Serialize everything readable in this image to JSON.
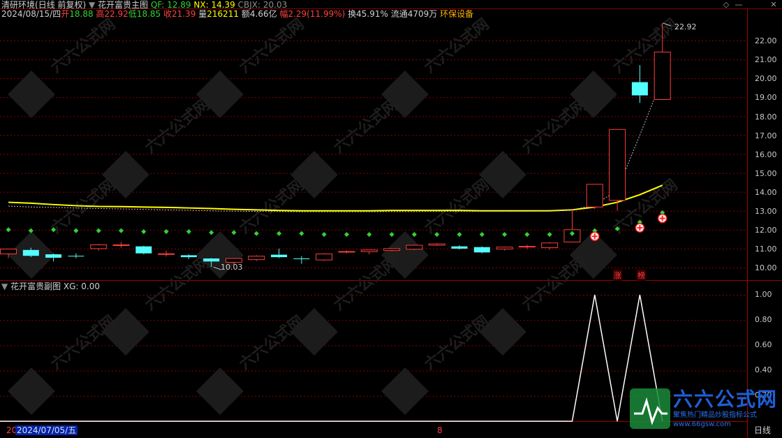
{
  "header": {
    "stock_name": "清研环境",
    "period": "(日线 前复权)",
    "indicator_name": "花开富贵主图",
    "indicator_values": [
      {
        "label": "QF: 12.89",
        "color": "#32d232"
      },
      {
        "label": "NX: 14.39",
        "color": "#ffff00"
      },
      {
        "label": "CBJX: 20.03",
        "color": "#8c8c8c"
      }
    ]
  },
  "quote": {
    "date": "2024/08/15/四",
    "open_label": "开",
    "open": "18.88",
    "high_label": "高",
    "high": "22.92",
    "low_label": "低",
    "low": "18.85",
    "close_label": "收",
    "close": "21.39",
    "volume_label": "量",
    "volume": "216211",
    "amount_label": "额",
    "amount": "4.66亿",
    "change_label": "幅",
    "change": "2.29(11.99%)",
    "turnover_label": "换",
    "turnover": "45.91%",
    "float_label": "流通",
    "float": "4709万",
    "sector": "环保设备"
  },
  "main_axis": {
    "ticks": [
      "22.00",
      "21.00",
      "20.00",
      "19.00",
      "18.00",
      "17.00",
      "16.00",
      "15.00",
      "14.00",
      "13.00",
      "12.00",
      "11.00",
      "10.00"
    ]
  },
  "sub_panel": {
    "indicator_name": "花开富贵副图",
    "indicator_value": "XG: 0.00",
    "ticks": [
      "1.00",
      "0.80",
      "0.60",
      "0.40",
      "0.20"
    ]
  },
  "footer": {
    "left_digit": "20",
    "cursor_date": "2024/07/05/五",
    "marker": "8",
    "period_label": "日线"
  },
  "labels": {
    "high_marker": "22.92",
    "low_marker": "10.03",
    "zhang": "涨",
    "bang": "榜"
  },
  "watermark": {
    "text": "六六公式网",
    "sub": "聚焦热门精品炒股指标公式",
    "url": "www.66gsw.com"
  },
  "window_icons": [
    "diamond-icon",
    "minimize-icon",
    "close-icon"
  ],
  "colors": {
    "up": "#ff3c3c",
    "down": "#54ffff",
    "ma_yellow": "#ffff00",
    "dot_green": "#32d232",
    "grid_red": "#8b0000"
  },
  "chart_data": {
    "type": "candlestick",
    "y_range": [
      9.6,
      23.2
    ],
    "candles": [
      {
        "o": 10.72,
        "c": 10.98,
        "h": 11.0,
        "l": 10.5
      },
      {
        "o": 10.93,
        "c": 10.62,
        "h": 11.05,
        "l": 10.55
      },
      {
        "o": 10.7,
        "c": 10.52,
        "h": 10.74,
        "l": 10.32
      },
      {
        "o": 10.62,
        "c": 10.6,
        "h": 10.75,
        "l": 10.5
      },
      {
        "o": 11.0,
        "c": 11.2,
        "h": 11.25,
        "l": 10.9
      },
      {
        "o": 11.17,
        "c": 11.2,
        "h": 11.35,
        "l": 11.05
      },
      {
        "o": 11.12,
        "c": 10.75,
        "h": 11.15,
        "l": 10.7
      },
      {
        "o": 10.72,
        "c": 10.73,
        "h": 10.9,
        "l": 10.58
      },
      {
        "o": 10.65,
        "c": 10.55,
        "h": 10.7,
        "l": 10.45
      },
      {
        "o": 10.48,
        "c": 10.32,
        "h": 10.5,
        "l": 10.03
      },
      {
        "o": 10.28,
        "c": 10.48,
        "h": 10.5,
        "l": 10.1
      },
      {
        "o": 10.42,
        "c": 10.6,
        "h": 10.65,
        "l": 10.35
      },
      {
        "o": 10.68,
        "c": 10.55,
        "h": 11.0,
        "l": 10.5
      },
      {
        "o": 10.48,
        "c": 10.45,
        "h": 10.6,
        "l": 10.2
      },
      {
        "o": 10.4,
        "c": 10.72,
        "h": 10.75,
        "l": 10.35
      },
      {
        "o": 10.82,
        "c": 10.85,
        "h": 10.9,
        "l": 10.75
      },
      {
        "o": 10.84,
        "c": 10.93,
        "h": 10.95,
        "l": 10.7
      },
      {
        "o": 10.9,
        "c": 11.0,
        "h": 11.02,
        "l": 10.85
      },
      {
        "o": 10.97,
        "c": 11.18,
        "h": 11.22,
        "l": 10.92
      },
      {
        "o": 11.18,
        "c": 11.25,
        "h": 11.3,
        "l": 11.15
      },
      {
        "o": 11.12,
        "c": 11.0,
        "h": 11.18,
        "l": 10.95
      },
      {
        "o": 11.08,
        "c": 10.8,
        "h": 11.12,
        "l": 10.75
      },
      {
        "o": 10.98,
        "c": 11.08,
        "h": 11.1,
        "l": 10.9
      },
      {
        "o": 11.1,
        "c": 11.12,
        "h": 11.2,
        "l": 10.98
      },
      {
        "o": 11.05,
        "c": 11.3,
        "h": 11.35,
        "l": 10.95
      },
      {
        "o": 11.35,
        "c": 12.0,
        "h": 13.05,
        "l": 11.35
      },
      {
        "o": 13.2,
        "c": 14.4,
        "h": 14.4,
        "l": 13.1
      },
      {
        "o": 13.55,
        "c": 17.3,
        "h": 17.3,
        "l": 13.0
      },
      {
        "o": 19.8,
        "c": 19.1,
        "h": 20.7,
        "l": 18.7
      },
      {
        "o": 18.88,
        "c": 21.39,
        "h": 22.92,
        "l": 18.85
      }
    ],
    "ma_yellow": [
      13.45,
      13.4,
      13.33,
      13.27,
      13.23,
      13.22,
      13.2,
      13.18,
      13.15,
      13.12,
      13.08,
      13.05,
      13.02,
      13.0,
      13.0,
      13.0,
      13.0,
      13.02,
      13.02,
      13.02,
      13.02,
      13.0,
      13.0,
      13.0,
      13.0,
      13.05,
      13.2,
      13.45,
      13.85,
      14.35
    ],
    "ma_dashed": [
      13.25,
      13.2,
      13.18,
      13.15,
      13.12,
      13.1,
      13.08,
      13.05,
      13.03,
      13.0,
      12.98,
      12.97,
      12.96,
      12.95,
      12.95,
      12.95,
      12.95,
      12.96,
      12.96,
      12.97,
      12.97,
      12.97,
      12.97,
      12.97,
      12.98,
      13.05,
      13.3,
      14.1,
      17.0,
      20.0
    ],
    "green_dots": [
      12.0,
      11.95,
      12.0,
      11.95,
      11.95,
      11.95,
      11.9,
      11.9,
      11.9,
      11.85,
      11.85,
      11.8,
      11.8,
      11.8,
      11.75,
      11.75,
      11.75,
      11.75,
      11.75,
      11.75,
      11.75,
      11.75,
      11.75,
      11.75,
      11.75,
      11.8,
      11.95,
      12.05,
      12.4,
      12.9
    ],
    "red_plus_marks": [
      {
        "i": 26,
        "v": 11.65
      },
      {
        "i": 28,
        "v": 12.1
      },
      {
        "i": 29,
        "v": 12.6
      }
    ],
    "xg_values": [
      0,
      0,
      0,
      0,
      0,
      0,
      0,
      0,
      0,
      0,
      0,
      0,
      0,
      0,
      0,
      0,
      0,
      0,
      0,
      0,
      0,
      0,
      0,
      0,
      0,
      0,
      1,
      0,
      1,
      0
    ],
    "xg_range": [
      0,
      1.1
    ]
  }
}
